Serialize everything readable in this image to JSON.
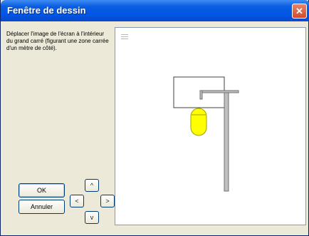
{
  "window": {
    "title": "Fenêtre de dessin",
    "close_symbol": "✕"
  },
  "instructions": "Déplacer l'image de l'écran  à l'intérieur du grand carré (figurant une zone carrée d'un mètre de côté).",
  "buttons": {
    "ok_label": "OK",
    "cancel_label": "Annuler",
    "up_label": "^",
    "left_label": "<",
    "right_label": ">",
    "down_label": "v"
  },
  "drawing": {
    "pole_color": "#c0c0c0",
    "lamp_color": "#ffff00",
    "lamp_outline": "#a0a000",
    "square_outline": "#404040"
  }
}
